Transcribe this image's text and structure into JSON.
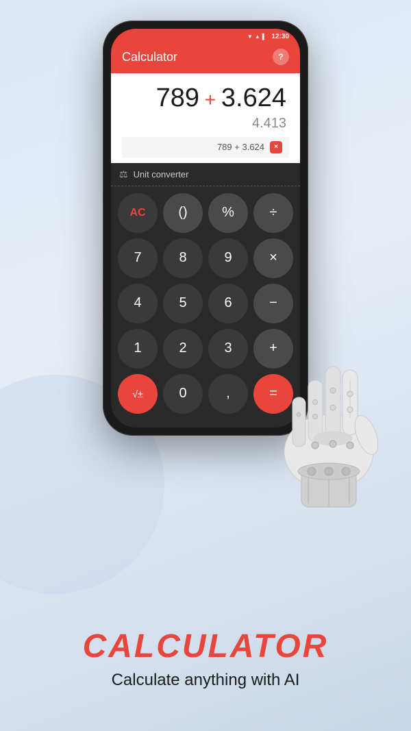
{
  "statusBar": {
    "time": "12:30",
    "icons": [
      "▼",
      "▲",
      "▌"
    ]
  },
  "appHeader": {
    "title": "Calculator",
    "helpLabel": "?"
  },
  "display": {
    "mainPart1": "789",
    "operator": "+",
    "mainPart2": "3.624",
    "result": "4.413",
    "expressionText": "789 + 3.624",
    "clearLabel": "×"
  },
  "unitConverter": {
    "label": "Unit converter",
    "icon": "⚖"
  },
  "keypad": {
    "rows": [
      [
        {
          "label": "AC",
          "type": "ac"
        },
        {
          "label": "()",
          "type": "op"
        },
        {
          "label": "%",
          "type": "op"
        },
        {
          "label": "÷",
          "type": "op"
        }
      ],
      [
        {
          "label": "7",
          "type": "dark"
        },
        {
          "label": "8",
          "type": "dark"
        },
        {
          "label": "9",
          "type": "dark"
        },
        {
          "label": "×",
          "type": "op"
        }
      ],
      [
        {
          "label": "4",
          "type": "dark"
        },
        {
          "label": "5",
          "type": "dark"
        },
        {
          "label": "6",
          "type": "dark"
        },
        {
          "label": "-",
          "type": "op"
        }
      ],
      [
        {
          "label": "1",
          "type": "dark"
        },
        {
          "label": "2",
          "type": "dark"
        },
        {
          "label": "3",
          "type": "dark"
        },
        {
          "label": "+",
          "type": "op"
        }
      ],
      [
        {
          "label": "√±",
          "type": "red-left"
        },
        {
          "label": "0",
          "type": "dark"
        },
        {
          "label": ",",
          "type": "dark"
        },
        {
          "label": "=",
          "type": "red"
        }
      ]
    ]
  },
  "bottomSection": {
    "appName": "CALCULATOR",
    "tagline": "Calculate anything with AI"
  }
}
